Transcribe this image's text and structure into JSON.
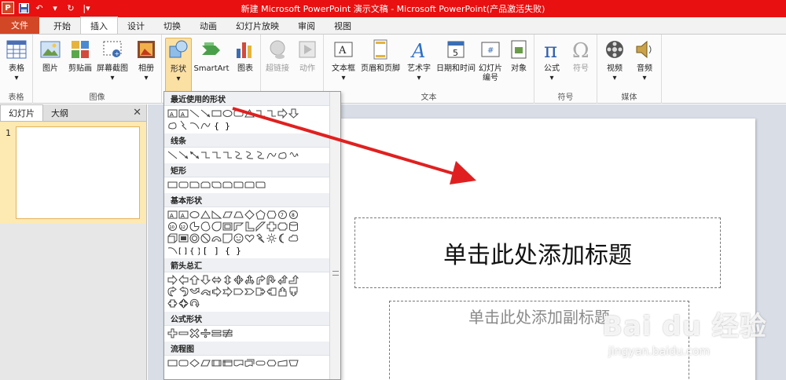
{
  "window": {
    "title": "新建 Microsoft PowerPoint 演示文稿 - Microsoft PowerPoint(产品激活失败)"
  },
  "tabs": [
    "文件",
    "开始",
    "插入",
    "设计",
    "切换",
    "动画",
    "幻灯片放映",
    "审阅",
    "视图"
  ],
  "active_tab": "插入",
  "ribbon": {
    "groups": {
      "table": "表格",
      "image": "图像",
      "text": "文本",
      "symbol": "符号",
      "media": "媒体"
    },
    "buttons": {
      "table": "表格",
      "picture": "图片",
      "clipart": "剪贴画",
      "screenshot": "屏幕截图",
      "album": "相册",
      "shapes": "形状",
      "smartart": "SmartArt",
      "chart": "图表",
      "hyperlink": "超链接",
      "action": "动作",
      "textbox": "文本框",
      "header_footer": "页眉和页脚",
      "wordart": "艺术字",
      "datetime": "日期和时间",
      "slide_number_1": "幻灯片",
      "slide_number_2": "编号",
      "object": "对象",
      "equation": "公式",
      "symbol": "符号",
      "video": "视频",
      "audio": "音频"
    }
  },
  "left_panel": {
    "tab_slides": "幻灯片",
    "tab_outline": "大纲",
    "close": "✕",
    "slide_number": "1"
  },
  "shapes_menu": {
    "sections": [
      "最近使用的形状",
      "线条",
      "矩形",
      "基本形状",
      "箭头总汇",
      "公式形状",
      "流程图"
    ]
  },
  "slide": {
    "title_placeholder": "单击此处添加标题",
    "subtitle_placeholder": "单击此处添加副标题"
  },
  "watermark": {
    "logo": "Bai du 经验",
    "url": "jingyan.baidu.com"
  },
  "colors": {
    "titlebar": "#e81010",
    "file_tab": "#d24726",
    "annotation_arrow": "#e02020"
  }
}
